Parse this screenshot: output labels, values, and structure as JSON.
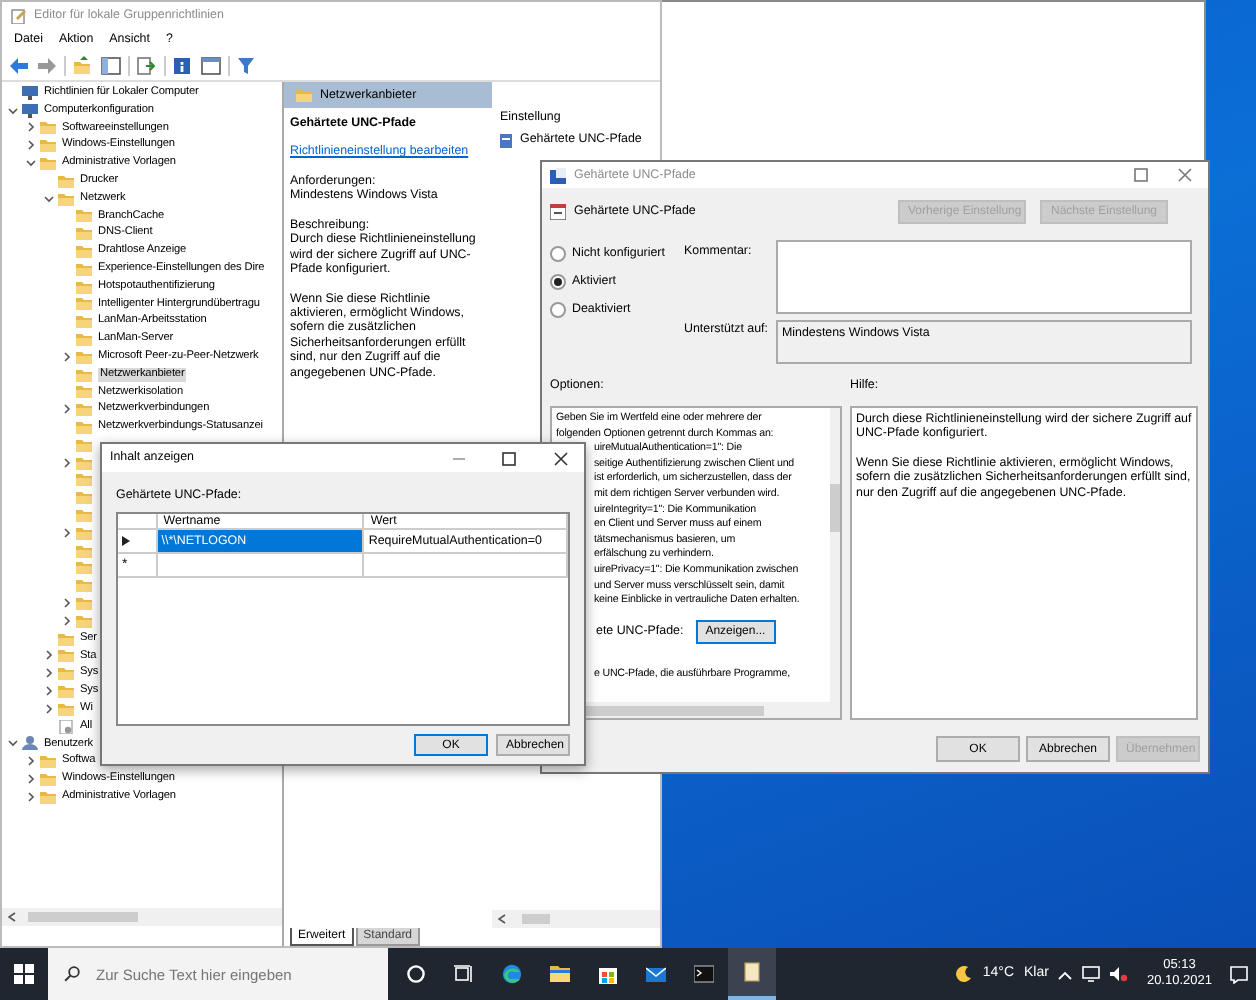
{
  "main_window": {
    "title": "Editor für lokale Gruppenrichtlinien",
    "menu": [
      "Datei",
      "Aktion",
      "Ansicht",
      "?"
    ],
    "tree": [
      {
        "label": "Richtlinien für Lokaler Computer",
        "kind": "computer"
      },
      {
        "label": "Computerkonfiguration",
        "kind": "computer",
        "expanded": true,
        "children": [
          {
            "label": "Softwareeinstellungen",
            "kind": "folder",
            "expanded": false
          },
          {
            "label": "Windows-Einstellungen",
            "kind": "folder",
            "expanded": false
          },
          {
            "label": "Administrative Vorlagen",
            "kind": "folder",
            "expanded": true,
            "children": [
              {
                "label": "Drucker",
                "kind": "folder"
              },
              {
                "label": "Netzwerk",
                "kind": "folder",
                "expanded": true,
                "children": [
                  {
                    "label": "BranchCache",
                    "kind": "folder"
                  },
                  {
                    "label": "DNS-Client",
                    "kind": "folder"
                  },
                  {
                    "label": "Drahtlose Anzeige",
                    "kind": "folder"
                  },
                  {
                    "label": "Experience-Einstellungen des Dire",
                    "kind": "folder"
                  },
                  {
                    "label": "Hotspotauthentifizierung",
                    "kind": "folder"
                  },
                  {
                    "label": "Intelligenter Hintergrundübertragu",
                    "kind": "folder"
                  },
                  {
                    "label": "LanMan-Arbeitsstation",
                    "kind": "folder"
                  },
                  {
                    "label": "LanMan-Server",
                    "kind": "folder"
                  },
                  {
                    "label": "Microsoft Peer-zu-Peer-Netzwerk",
                    "kind": "folder",
                    "expanded": false
                  },
                  {
                    "label": "Netzwerkanbieter",
                    "kind": "folder",
                    "selected": true
                  },
                  {
                    "label": "Netzwerkisolation",
                    "kind": "folder"
                  },
                  {
                    "label": "Netzwerkverbindungen",
                    "kind": "folder",
                    "expanded": false
                  },
                  {
                    "label": "Netzwerkverbindungs-Statusanzei",
                    "kind": "folder"
                  },
                  {
                    "kind": "folder"
                  },
                  {
                    "kind": "folder",
                    "expanded": false
                  },
                  {
                    "kind": "folder"
                  },
                  {
                    "kind": "folder"
                  },
                  {
                    "kind": "folder"
                  },
                  {
                    "kind": "folder",
                    "expanded": false
                  },
                  {
                    "kind": "folder"
                  },
                  {
                    "kind": "folder"
                  },
                  {
                    "kind": "folder"
                  },
                  {
                    "kind": "folder",
                    "expanded": false
                  },
                  {
                    "kind": "folder",
                    "expanded": false
                  }
                ]
              },
              {
                "label": "Ser",
                "kind": "folder"
              },
              {
                "label": "Sta",
                "kind": "folder",
                "expanded": false
              },
              {
                "label": "Sys",
                "kind": "folder",
                "expanded": false
              },
              {
                "label": "Sys",
                "kind": "folder",
                "expanded": false
              },
              {
                "label": "Wi",
                "kind": "folder",
                "expanded": false
              },
              {
                "label": "All",
                "kind": "settings"
              }
            ]
          }
        ]
      },
      {
        "label": "Benutzerk",
        "kind": "user",
        "expanded": true,
        "children": [
          {
            "label": "Softwa",
            "kind": "folder",
            "expanded": false
          },
          {
            "label": "Windows-Einstellungen",
            "kind": "folder",
            "expanded": false
          },
          {
            "label": "Administrative Vorlagen",
            "kind": "folder",
            "expanded": false
          }
        ]
      }
    ],
    "detail": {
      "header": "Netzwerkanbieter",
      "policy_title": "Gehärtete UNC-Pfade",
      "edit_link": "Richtlinieneinstellung bearbeiten",
      "requirements_label": "Anforderungen:",
      "requirements": "Mindestens Windows Vista",
      "description_label": "Beschreibung:",
      "description": [
        "Durch diese Richtlinieneinstellung wird der sichere Zugriff auf UNC-Pfade konfiguriert.",
        "Wenn Sie diese Richtlinie aktivieren, ermöglicht Windows, sofern die zusätzlichen Sicherheitsanforderungen erfüllt sind, nur den Zugriff auf die angegebenen UNC-Pfade."
      ]
    },
    "list": {
      "column": "Einstellung",
      "items": [
        "Gehärtete UNC-Pfade"
      ]
    },
    "tabs": [
      {
        "label": "Erweitert",
        "selected": true
      },
      {
        "label": "Standard",
        "selected": false
      }
    ]
  },
  "content_dialog": {
    "title": "Inhalt anzeigen",
    "label": "Gehärtete UNC-Pfade:",
    "columns": [
      "Wertname",
      "Wert"
    ],
    "rows": [
      {
        "kind": "current",
        "name": "\\\\*\\NETLOGON",
        "value": "RequireMutualAuthentication=0",
        "selected": true
      },
      {
        "kind": "new",
        "marker": "*"
      }
    ],
    "buttons": [
      {
        "label": "OK",
        "default": true
      },
      {
        "label": "Abbrechen",
        "default": false
      }
    ]
  },
  "policy_dialog": {
    "title": "Gehärtete UNC-Pfade",
    "heading": "Gehärtete UNC-Pfade",
    "nav_buttons": [
      {
        "label": "Vorherige Einstellung",
        "disabled": true
      },
      {
        "label": "Nächste Einstellung",
        "disabled": true
      }
    ],
    "states": [
      {
        "label": "Nicht konfiguriert",
        "selected": false
      },
      {
        "label": "Aktiviert",
        "selected": true
      },
      {
        "label": "Deaktiviert",
        "selected": false
      }
    ],
    "comment_label": "Kommentar:",
    "supported_label": "Unterstützt auf:",
    "supported": "Mindestens Windows Vista",
    "options_label": "Optionen:",
    "help_label": "Hilfe:",
    "option_intro": [
      "Geben Sie im Wertfeld eine oder mehrere der",
      "folgenden Optionen getrennt durch Kommas an:"
    ],
    "option_lines": [
      "uireMutualAuthentication=1\": Die",
      "seitige Authentifizierung zwischen Client und",
      "ist erforderlich, um sicherzustellen, dass der",
      "mit dem richtigen Server verbunden wird.",
      "uireIntegrity=1\": Die Kommunikation",
      "en Client und Server muss auf einem",
      "tätsmechanismus basieren, um",
      "erfälschung zu verhindern.",
      "uirePrivacy=1\": Die Kommunikation zwischen",
      "und Server muss verschlüsselt sein, damit",
      "keine Einblicke in vertrauliche Daten erhalten."
    ],
    "show_label": "ete UNC-Pfade:",
    "show_button": "Anzeigen...",
    "option_tail": "e UNC-Pfade, die ausführbare Programme,",
    "help": [
      "Durch diese Richtlinieneinstellung wird der sichere Zugriff auf UNC-Pfade konfiguriert.",
      "Wenn Sie diese Richtlinie aktivieren, ermöglicht Windows, sofern die zusätzlichen Sicherheitsanforderungen erfüllt sind, nur den Zugriff auf die angegebenen UNC-Pfade."
    ],
    "buttons": [
      {
        "label": "OK",
        "disabled": false
      },
      {
        "label": "Abbrechen",
        "disabled": false
      },
      {
        "label": "Übernehmen",
        "disabled": true
      }
    ]
  },
  "taskbar": {
    "search_placeholder": "Zur Suche Text hier eingeben",
    "apps": [
      {
        "kind": "cortana",
        "selected": false
      },
      {
        "kind": "taskview",
        "selected": false
      },
      {
        "kind": "edge",
        "selected": false
      },
      {
        "kind": "explorer",
        "selected": false
      },
      {
        "kind": "store",
        "selected": false
      },
      {
        "kind": "mail",
        "selected": false
      },
      {
        "kind": "terminal",
        "selected": false
      },
      {
        "kind": "gpedit",
        "selected": true
      }
    ],
    "temperature": "14°C",
    "weather": "Klar",
    "time": "05:13",
    "date": "20.10.2021"
  }
}
